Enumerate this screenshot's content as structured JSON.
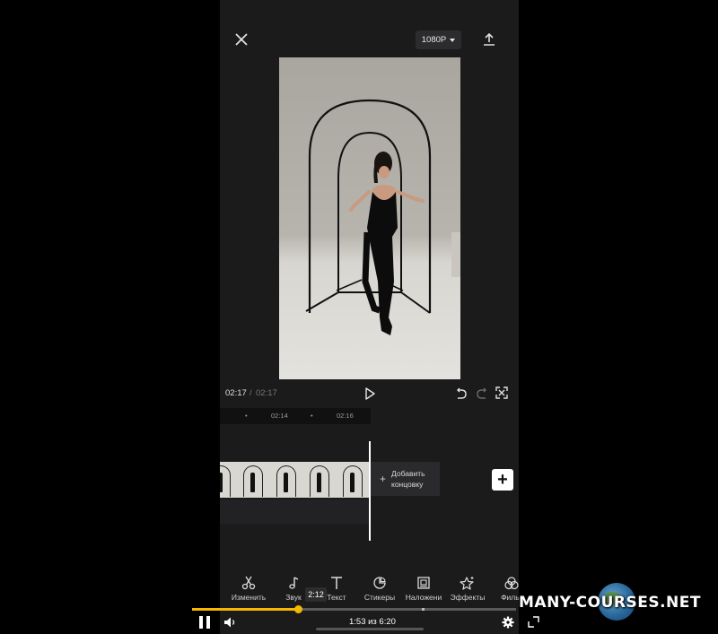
{
  "editor": {
    "resolution": "1080P",
    "time_current": "02:17",
    "time_separator": "/",
    "time_total": "02:17",
    "ruler_ticks": [
      "•",
      "02:14",
      "•",
      "02:16"
    ],
    "add_ending_label": "Добавить\nконцовку",
    "add_ending_plus": "+",
    "add_button": "+"
  },
  "toolbar": {
    "items": [
      {
        "label": "Изменить",
        "icon": "scissors-icon"
      },
      {
        "label": "Звук",
        "icon": "music-note-icon"
      },
      {
        "label": "Текст",
        "icon": "text-icon"
      },
      {
        "label": "Стикеры",
        "icon": "sticker-icon"
      },
      {
        "label": "Наложени",
        "icon": "overlay-icon"
      },
      {
        "label": "Эффекты",
        "icon": "effects-star-icon"
      },
      {
        "label": "Фильт",
        "icon": "filter-icon"
      }
    ]
  },
  "player": {
    "progress_fraction": 0.327,
    "hover_time": "2:12",
    "time_label": "1:53 из 6:20"
  },
  "watermark": "MANY-COURSES.NET",
  "colors": {
    "accent": "#f5b800",
    "editor_bg": "#1b1b1c"
  }
}
